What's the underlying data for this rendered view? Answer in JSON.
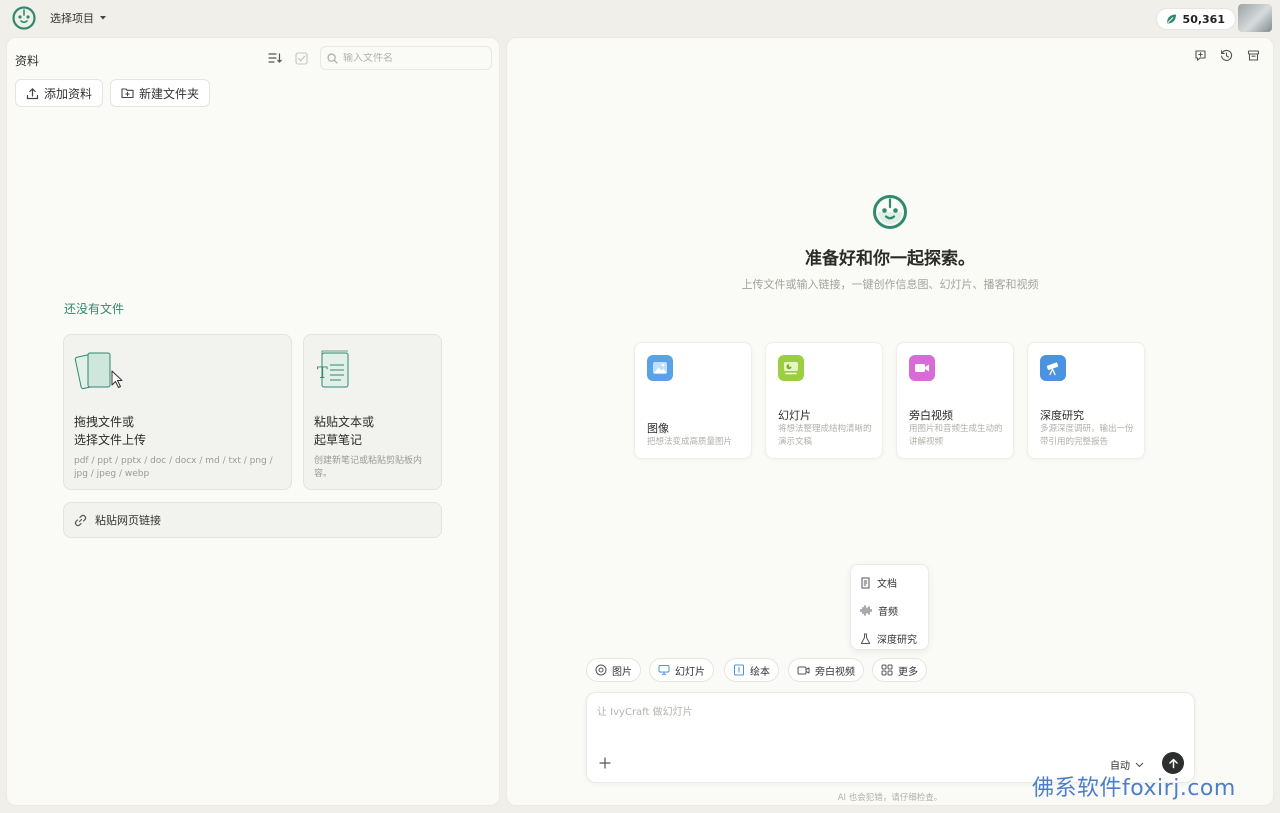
{
  "topbar": {
    "project_select": "选择项目",
    "credits": "50,361"
  },
  "left": {
    "title": "资料",
    "search_placeholder": "输入文件名",
    "add_button": "添加资料",
    "new_folder_button": "新建文件夹",
    "empty_title": "还没有文件",
    "upload_card": {
      "title_line1": "拖拽文件或",
      "title_line2": "选择文件上传",
      "formats": "pdf / ppt / pptx / doc / docx / md / txt / png / jpg / jpeg / webp"
    },
    "paste_card": {
      "title_line1": "粘贴文本或",
      "title_line2": "起草笔记",
      "desc": "创建新笔记或粘贴剪贴板内容。"
    },
    "link_label": "粘贴网页链接"
  },
  "right": {
    "hero_title": "准备好和你一起探索。",
    "hero_subtitle": "上传文件或输入链接，一键创作信息图、幻灯片、播客和视频",
    "features": [
      {
        "name": "图像",
        "desc": "把想法变成高质量图片",
        "color": "#5aa2e8"
      },
      {
        "name": "幻灯片",
        "desc": "将想法整理成结构清晰的演示文稿",
        "color": "#9ccf3f"
      },
      {
        "name": "旁白视频",
        "desc": "用图片和音频生成生动的讲解视频",
        "color": "#d96bd8"
      },
      {
        "name": "深度研究",
        "desc": "多源深度调研，输出一份带引用的完整报告",
        "color": "#4b93e0"
      }
    ],
    "dropdown": [
      "文档",
      "音频",
      "深度研究"
    ],
    "chips": [
      "图片",
      "幻灯片",
      "绘本",
      "旁白视频",
      "更多"
    ],
    "composer_placeholder": "让 IvyCraft 做幻灯片",
    "mode": "自动",
    "disclaimer": "AI 也会犯错，请仔细检查。"
  },
  "watermark": "佛系软件foxirj.com",
  "colors": {
    "brand": "#2f8a6e",
    "send": "#2c2f2d"
  }
}
